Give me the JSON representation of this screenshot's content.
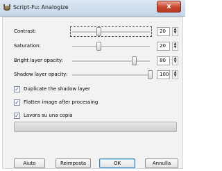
{
  "window": {
    "title": "Script-Fu: Analogize",
    "close_label": "x"
  },
  "sliders": [
    {
      "label": "Contrast:",
      "value": "20",
      "level": 0.2
    },
    {
      "label": "Saturation:",
      "value": "20",
      "level": 0.2
    },
    {
      "label": "Bright layer opacity:",
      "value": "80",
      "level": 0.8
    },
    {
      "label": "Shadow layer opacity:",
      "value": "100",
      "level": 1.0
    }
  ],
  "checkboxes": [
    {
      "label": "Duplicate the shadow layer",
      "checked": true
    },
    {
      "label": "Flatten image after processing",
      "checked": true
    },
    {
      "label": "Lavora su una copia",
      "checked": true
    }
  ],
  "progress": {
    "level": 0
  },
  "buttons": {
    "help": "Aiuto",
    "reset": "Reimposta",
    "ok": "OK",
    "cancel": "Annulla"
  },
  "colors": {
    "title_bar": "#c3d4e9",
    "close_button": "#c8472f",
    "ok_focus": "#3c7fb1"
  }
}
